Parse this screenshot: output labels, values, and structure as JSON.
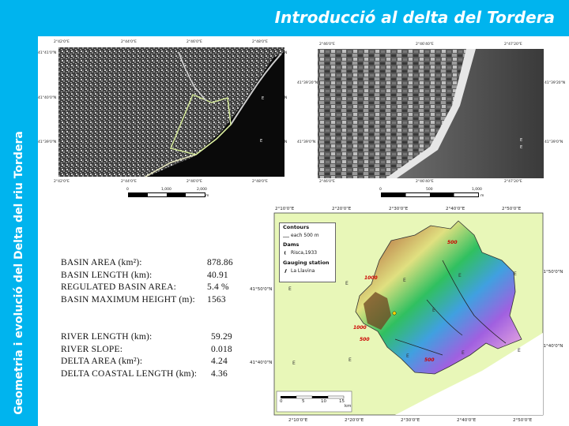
{
  "header": {
    "title": "Introducció al delta del Tordera",
    "bg_color": "#00b4ee"
  },
  "sidebar": {
    "vertical_title": "Geometria i evolució del Delta del riu Tordera"
  },
  "photo_left": {
    "top_ticks": [
      "2°42'0\"E",
      "2°44'0\"E",
      "2°46'0\"E",
      "2°48'0\"E"
    ],
    "bottom_ticks": [
      "2°42'0\"E",
      "2°44'0\"E",
      "2°46'0\"E",
      "2°48'0\"E"
    ],
    "left_ticks": [
      "41°41'0\"N",
      "41°40'0\"N",
      "41°39'0\"N"
    ],
    "right_ticks": [
      "41°41'0\"N",
      "41°40'0\"N",
      "41°39'0\"N"
    ],
    "scale_labels": [
      "0",
      "1,000",
      "2,000"
    ],
    "scale_unit": "m",
    "e_marks": [
      "E",
      "E"
    ]
  },
  "photo_right": {
    "top_ticks": [
      "2°46'0\"E",
      "2°46'40\"E",
      "2°47'20\"E"
    ],
    "bottom_ticks": [
      "2°46'0\"E",
      "2°46'40\"E",
      "2°47'20\"E"
    ],
    "left_ticks": [
      "41°39'20\"N",
      "41°39'0\"N"
    ],
    "right_ticks": [
      "41°39'20\"N",
      "41°39'0\"N"
    ],
    "scale_labels": [
      "0",
      "500",
      "1,000"
    ],
    "scale_unit": "m",
    "e_marks": [
      "E",
      "E"
    ]
  },
  "basin_map": {
    "top_ticks": [
      "2°10'0\"E",
      "2°20'0\"E",
      "2°30'0\"E",
      "2°40'0\"E",
      "2°50'0\"E"
    ],
    "bottom_ticks": [
      "2°10'0\"E",
      "2°20'0\"E",
      "2°30'0\"E",
      "2°40'0\"E",
      "2°50'0\"E"
    ],
    "left_ticks": [
      "41°50'0\"N",
      "41°40'0\"N"
    ],
    "right_ticks": [
      "41°50'0\"N",
      "41°40'0\"N"
    ],
    "legend": {
      "contours_title": "Contours",
      "contours_item": "each 500 m",
      "dams_title": "Dams",
      "dams_item": "Risca,1933",
      "gauging_title": "Gauging station",
      "gauging_item": "La Llavina"
    },
    "contour_labels": [
      "500",
      "1000",
      "1000",
      "500",
      "500"
    ],
    "e_marks": [
      "E",
      "E",
      "E",
      "E",
      "E",
      "E",
      "E",
      "E",
      "E",
      "E",
      "E"
    ],
    "scale_labels": [
      "0",
      "5",
      "10",
      "15"
    ],
    "scale_unit": "km"
  },
  "stats_block_1": [
    {
      "label": "BASIN AREA (km²):",
      "value": "878.86"
    },
    {
      "label": "BASIN LENGTH (km):",
      "value": "40.91"
    },
    {
      "label": "REGULATED BASIN AREA:",
      "value": "5.4 %"
    },
    {
      "label": "BASIN MAXIMUM HEIGHT (m):",
      "value": "1563"
    }
  ],
  "stats_block_2": [
    {
      "label": "RIVER LENGTH (km):",
      "value": "59.29"
    },
    {
      "label": "RIVER SLOPE:",
      "value": "0.018"
    },
    {
      "label": "DELTA AREA (km²):",
      "value": "4.24"
    },
    {
      "label": "DELTA COASTAL LENGTH (km):",
      "value": "4.36"
    }
  ]
}
